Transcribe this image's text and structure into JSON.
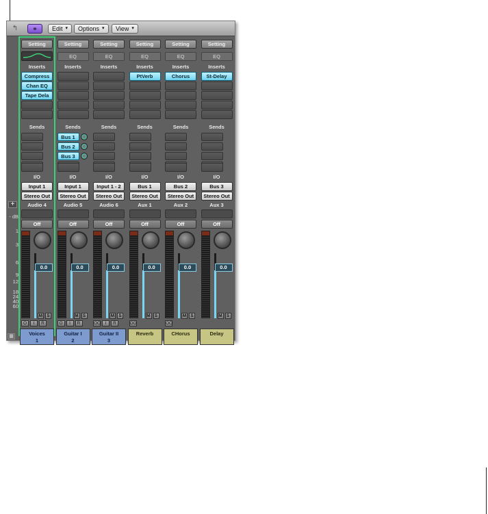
{
  "toolbar": {
    "link_icon": "link-icon",
    "edit_label": "Edit",
    "options_label": "Options",
    "view_label": "View",
    "arrow": "▾",
    "up_icon": "↰"
  },
  "meter_scale": [
    "- dB",
    "1",
    "3",
    "6",
    "9",
    "12",
    "18",
    "24",
    "40",
    "60"
  ],
  "plus_label": "+",
  "strips": [
    {
      "setting": "Setting",
      "eq": "",
      "inserts_label": "Inserts",
      "inserts": [
        "Compress",
        "Chan EQ",
        "Tape Dela"
      ],
      "sends_label": "Sends",
      "sends": [],
      "io_label": "I/O",
      "input": "Input 1",
      "output": "Stereo Out",
      "channel": "Audio 4",
      "automation": "Off",
      "value": "0.0",
      "name": "Voices",
      "number": "1",
      "color": "blue",
      "bottom": [
        "O",
        "I",
        "R"
      ],
      "ms": [
        "M",
        "S"
      ]
    },
    {
      "setting": "Setting",
      "eq": "EQ",
      "inserts_label": "Inserts",
      "inserts": [],
      "sends_label": "Sends",
      "sends": [
        "Bus 1",
        "Bus 2",
        "Bus 3"
      ],
      "io_label": "I/O",
      "input": "Input 1",
      "output": "Stereo Out",
      "channel": "Audio 5",
      "automation": "Off",
      "value": "0.0",
      "name": "Guitar I",
      "number": "2",
      "color": "blue",
      "bottom": [
        "O",
        "I",
        "R"
      ],
      "ms": [
        "M",
        "S"
      ]
    },
    {
      "setting": "Setting",
      "eq": "EQ",
      "inserts_label": "Inserts",
      "inserts": [],
      "sends_label": "Sends",
      "sends": [],
      "io_label": "I/O",
      "input": "Input 1 - 2",
      "output": "Stereo Out",
      "channel": "Audio 6",
      "automation": "Off",
      "value": "0.0",
      "name": "Guitar II",
      "number": "3",
      "color": "blue",
      "bottom": [
        "OO",
        "I",
        "R"
      ],
      "ms": [
        "M",
        "S"
      ]
    },
    {
      "setting": "Setting",
      "eq": "EQ",
      "inserts_label": "Inserts",
      "inserts": [
        "PtVerb"
      ],
      "sends_label": "Sends",
      "sends": [],
      "io_label": "I/O",
      "input": "Bus 1",
      "output": "Stereo Out",
      "channel": "Aux 1",
      "automation": "Off",
      "value": "0.0",
      "name": "Reverb",
      "number": "",
      "color": "yellow",
      "bottom": [
        "OO"
      ],
      "ms": [
        "M",
        "S"
      ]
    },
    {
      "setting": "Setting",
      "eq": "EQ",
      "inserts_label": "Inserts",
      "inserts": [
        "Chorus"
      ],
      "sends_label": "Sends",
      "sends": [],
      "io_label": "I/O",
      "input": "Bus 2",
      "output": "Stereo Out",
      "channel": "Aux 2",
      "automation": "Off",
      "value": "0.0",
      "name": "CHorus",
      "number": "",
      "color": "yellow",
      "bottom": [
        "OO"
      ],
      "ms": [
        "M",
        "S"
      ]
    },
    {
      "setting": "Setting",
      "eq": "EQ",
      "inserts_label": "Inserts",
      "inserts": [
        "St-Delay"
      ],
      "sends_label": "Sends",
      "sends": [],
      "io_label": "I/O",
      "input": "Bus 3",
      "output": "Stereo Out",
      "channel": "Aux 3",
      "automation": "Off",
      "value": "0.0",
      "name": "Delay",
      "number": "",
      "color": "yellow",
      "bottom": [],
      "ms": [
        "M",
        "S"
      ]
    }
  ],
  "colors": {
    "plugin": "#6fd3ee",
    "selected": "#3fd07a",
    "blue_strip": "#7e9bd0",
    "yellow_strip": "#c6c584"
  }
}
